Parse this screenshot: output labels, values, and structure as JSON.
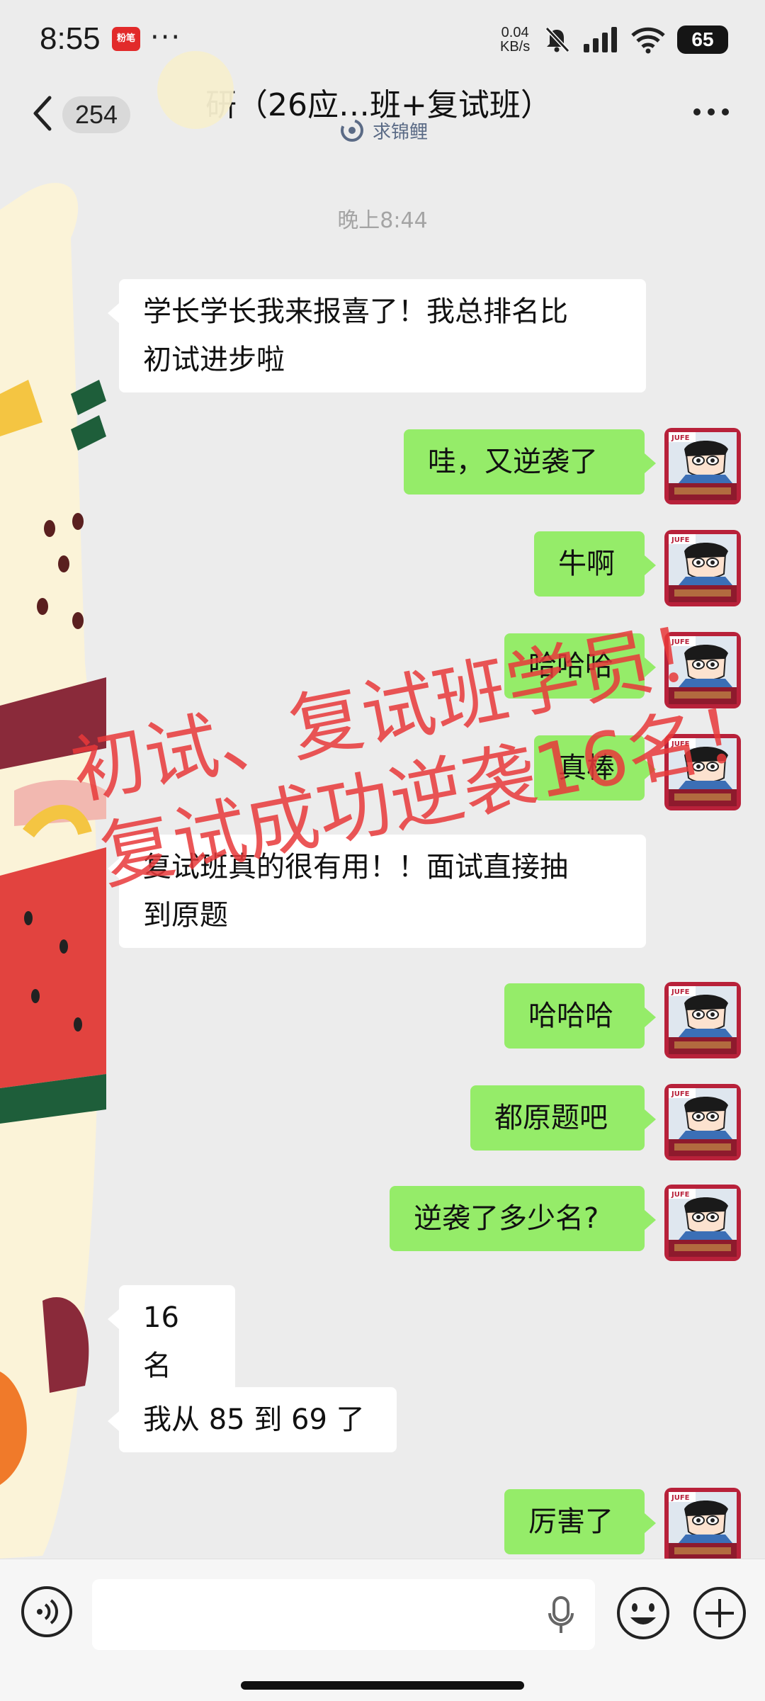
{
  "status_bar": {
    "time": "8:55",
    "app_badge": "粉笔",
    "dots": "···",
    "net_speed_value": "0.04",
    "net_speed_unit": "KB/s",
    "battery": "65",
    "icons": [
      "mute-icon",
      "signal-icon",
      "wifi-icon",
      "battery-icon"
    ]
  },
  "header": {
    "unread_count": "254",
    "title": "研（26应…班+复试班）",
    "subtitle": "求锦鲤",
    "accent": "#5b6b86"
  },
  "chat": {
    "timestamp": "晚上8:44",
    "messages": [
      {
        "side": "left",
        "lines": [
          "学长学长我来报喜了！我总排名比",
          "初试进步啦"
        ]
      },
      {
        "side": "right",
        "lines": [
          "哇，又逆袭了"
        ]
      },
      {
        "side": "right",
        "lines": [
          "牛啊"
        ]
      },
      {
        "side": "right",
        "lines": [
          "哈哈哈"
        ]
      },
      {
        "side": "right",
        "lines": [
          "真棒"
        ]
      },
      {
        "side": "left",
        "lines": [
          "复试班真的很有用！！面试直接抽",
          "到原题"
        ]
      },
      {
        "side": "right",
        "lines": [
          "哈哈哈"
        ]
      },
      {
        "side": "right",
        "lines": [
          "都原题吧"
        ]
      },
      {
        "side": "right",
        "lines": [
          "逆袭了多少名?"
        ]
      },
      {
        "side": "left",
        "lines": [
          "16 名"
        ]
      },
      {
        "side": "left",
        "lines": [
          "我从 85 到 69 了"
        ]
      },
      {
        "side": "right",
        "lines": [
          "厉害了"
        ]
      }
    ],
    "avatar_label": "JUFE",
    "watermark_lines": [
      "初试、复试班学员！",
      "复试成功逆袭16名！"
    ],
    "colors": {
      "right_bubble": "#95ec69",
      "left_bubble": "#ffffff",
      "watermark": "#e8383a"
    }
  },
  "input_bar": {
    "placeholder": "",
    "icons": [
      "voice-icon",
      "microphone-icon",
      "emoji-icon",
      "plus-icon"
    ]
  }
}
